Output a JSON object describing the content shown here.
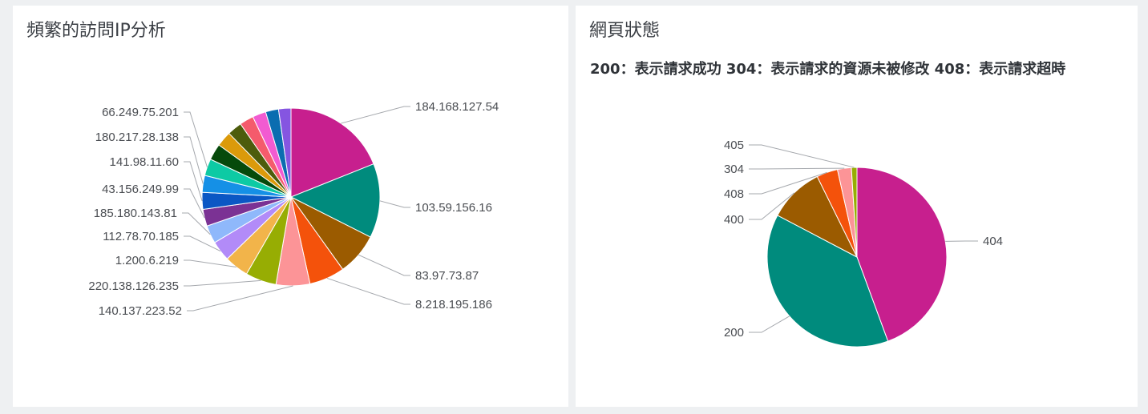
{
  "panels": {
    "left": {
      "title": "頻繁的訪問IP分析"
    },
    "right": {
      "title": "網頁狀態",
      "subtitle": "200：表示請求成功 304：表示請求的資源未被修改 408：表示請求超時"
    }
  },
  "chart_data": [
    {
      "type": "pie",
      "title": "頻繁的訪問IP分析",
      "start_angle_deg": 0,
      "slices": [
        {
          "label": "184.168.127.54",
          "value": 18.5,
          "color": "#c71f8e",
          "labeled": true,
          "side": "right"
        },
        {
          "label": "103.59.156.16",
          "value": 13.2,
          "color": "#008b7d",
          "labeled": true,
          "side": "right"
        },
        {
          "label": "83.97.73.87",
          "value": 7.5,
          "color": "#9b5b00",
          "labeled": true,
          "side": "right"
        },
        {
          "label": "8.218.195.186",
          "value": 6.3,
          "color": "#f4520b",
          "labeled": true,
          "side": "right"
        },
        {
          "label": "140.137.223.52",
          "value": 6.0,
          "color": "#fc9497",
          "labeled": true,
          "side": "left"
        },
        {
          "label": "220.138.126.235",
          "value": 5.5,
          "color": "#97ad03",
          "labeled": true,
          "side": "left"
        },
        {
          "label": "1.200.6.219",
          "value": 4.3,
          "color": "#f2b44a",
          "labeled": true,
          "side": "left"
        },
        {
          "label": "112.78.70.185",
          "value": 3.6,
          "color": "#b28bf8",
          "labeled": true,
          "side": "left"
        },
        {
          "label": "185.180.143.81",
          "value": 3.2,
          "color": "#8fb8fb",
          "labeled": true,
          "side": "left"
        },
        {
          "label": "43.156.249.99",
          "value": 3.0,
          "color": "#7b3294",
          "labeled": true,
          "side": "left"
        },
        {
          "label": "141.98.11.60",
          "value": 3.0,
          "color": "#0b57c4",
          "labeled": true,
          "side": "left"
        },
        {
          "label": "180.217.28.138",
          "value": 3.0,
          "color": "#1590e6",
          "labeled": true,
          "side": "left"
        },
        {
          "label": "66.249.75.201",
          "value": 3.0,
          "color": "#0dcaa4",
          "labeled": true,
          "side": "left"
        },
        {
          "label": "",
          "value": 2.9,
          "color": "#064a0b",
          "labeled": false
        },
        {
          "label": "",
          "value": 2.7,
          "color": "#db9a0a",
          "labeled": false
        },
        {
          "label": "",
          "value": 2.6,
          "color": "#4d5c0c",
          "labeled": false
        },
        {
          "label": "",
          "value": 2.5,
          "color": "#f45b6c",
          "labeled": false
        },
        {
          "label": "",
          "value": 2.4,
          "color": "#f25bd1",
          "labeled": false
        },
        {
          "label": "",
          "value": 2.3,
          "color": "#0b6db0",
          "labeled": false
        },
        {
          "label": "",
          "value": 2.2,
          "color": "#8555e1",
          "labeled": false
        }
      ]
    },
    {
      "type": "pie",
      "title": "網頁狀態",
      "start_angle_deg": 0,
      "slices": [
        {
          "label": "404",
          "value": 44.4,
          "color": "#c71f8e",
          "labeled": true,
          "side": "right"
        },
        {
          "label": "200",
          "value": 38.3,
          "color": "#008b7d",
          "labeled": true,
          "side": "left"
        },
        {
          "label": "400",
          "value": 10.0,
          "color": "#9b5b00",
          "labeled": true,
          "side": "left"
        },
        {
          "label": "408",
          "value": 3.8,
          "color": "#f4520b",
          "labeled": true,
          "side": "left"
        },
        {
          "label": "304",
          "value": 2.5,
          "color": "#fc9497",
          "labeled": true,
          "side": "left"
        },
        {
          "label": "405",
          "value": 1.0,
          "color": "#97ad03",
          "labeled": true,
          "side": "left"
        }
      ]
    }
  ]
}
